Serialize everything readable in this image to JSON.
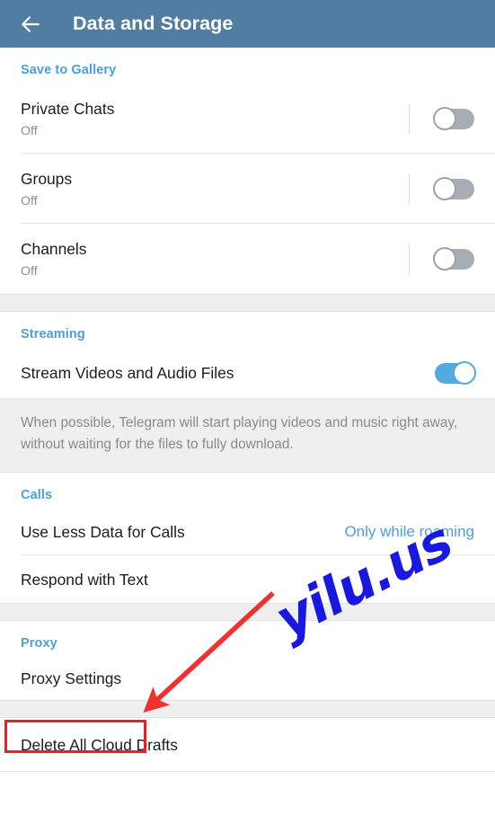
{
  "toolbar": {
    "back_icon": "arrow-left-icon",
    "title": "Data and Storage"
  },
  "sections": {
    "save_to_gallery": {
      "header": "Save to Gallery",
      "rows": [
        {
          "title": "Private Chats",
          "subtitle": "Off",
          "toggle": "off"
        },
        {
          "title": "Groups",
          "subtitle": "Off",
          "toggle": "off"
        },
        {
          "title": "Channels",
          "subtitle": "Off",
          "toggle": "off"
        }
      ]
    },
    "streaming": {
      "header": "Streaming",
      "row": {
        "title": "Stream Videos and Audio Files",
        "toggle": "on"
      },
      "info": "When possible, Telegram will start playing videos and music right away, without waiting for the files to fully download."
    },
    "calls": {
      "header": "Calls",
      "rows": [
        {
          "title": "Use Less Data for Calls",
          "value": "Only while roaming"
        },
        {
          "title": "Respond with Text",
          "value": ""
        }
      ]
    },
    "proxy": {
      "header": "Proxy",
      "rows": [
        {
          "title": "Proxy Settings"
        }
      ]
    },
    "drafts": {
      "rows": [
        {
          "title": "Delete All Cloud Drafts"
        }
      ]
    }
  },
  "annotations": {
    "watermark_text": "yilu.us",
    "watermark_color": "#1818e0",
    "highlight_color": "#f01e20"
  },
  "colors": {
    "toolbar": "#517da2",
    "accent_blue": "#4a9fe0",
    "toggle_on": "#54aade",
    "toggle_off": "#a6adb4",
    "band_gray": "#efefef"
  }
}
